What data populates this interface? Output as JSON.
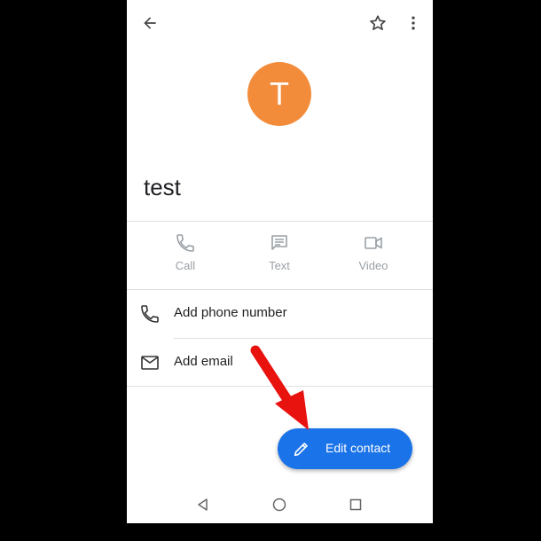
{
  "contact": {
    "initial": "T",
    "name": "test",
    "avatar_color": "#f28c3b"
  },
  "topbar": {
    "back_icon": "arrow-back-icon",
    "star_icon": "star-outline-icon",
    "more_icon": "more-vert-icon"
  },
  "actions": [
    {
      "label": "Call",
      "icon": "phone-icon"
    },
    {
      "label": "Text",
      "icon": "message-icon"
    },
    {
      "label": "Video",
      "icon": "videocam-icon"
    }
  ],
  "rows": [
    {
      "label": "Add phone number",
      "icon": "phone-icon"
    },
    {
      "label": "Add email",
      "icon": "mail-icon"
    }
  ],
  "fab": {
    "label": "Edit contact",
    "icon": "pencil-icon",
    "color": "#1a73e8"
  },
  "annotation": {
    "arrow_color": "#e8120f"
  },
  "navbar": {
    "back_icon": "nav-back-icon",
    "home_icon": "nav-home-icon",
    "recents_icon": "nav-recents-icon"
  }
}
